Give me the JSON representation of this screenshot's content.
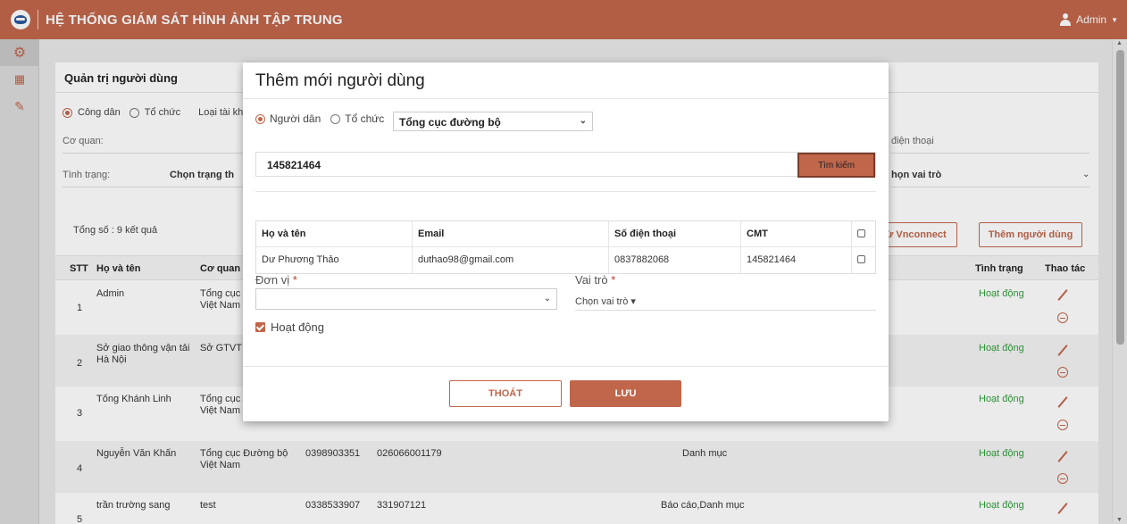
{
  "app": {
    "title": "HỆ THỐNG GIÁM SÁT HÌNH ẢNH TẬP TRUNG",
    "user": "Admin"
  },
  "sidebar": {
    "items": [
      {
        "icon": "gear-icon"
      },
      {
        "icon": "calendar-icon"
      },
      {
        "icon": "edit-icon"
      }
    ]
  },
  "panel": {
    "title": "Quản trị người dùng",
    "radio_citizen": "Công dân",
    "radio_org": "Tổ chức",
    "account_type_label": "Loại tài kh",
    "agency_label": "Cơ quan:",
    "phone_label": "điện thoại",
    "status_label": "Tình trạng:",
    "status_value": "Chọn trạng th",
    "role_value": "họn vai trò",
    "total": "Tổng số : 9 kết quả",
    "vnconnect_button": "ừ Vnconnect",
    "add_user_button": "Thêm người dùng"
  },
  "table": {
    "headers": {
      "stt": "STT",
      "name": "Họ và tên",
      "agency": "Cơ quan",
      "status": "Tình trạng",
      "action": "Thao tác"
    },
    "rows": [
      {
        "stt": "1",
        "name_1": "Admin",
        "name_2": "",
        "agency_1": "Tổng cục",
        "agency_2": "Việt Nam",
        "phone": "",
        "id": "",
        "role": "",
        "status": "Hoạt động"
      },
      {
        "stt": "2",
        "name_1": "Sở giao thông vận tải",
        "name_2": "Hà Nội",
        "agency_1": "Sở GTVT H",
        "agency_2": "",
        "phone": "",
        "id": "",
        "role": "",
        "status": "Hoạt động"
      },
      {
        "stt": "3",
        "name_1": "Tống Khánh Linh",
        "name_2": "",
        "agency_1": "Tổng cục",
        "agency_2": "Việt Nam",
        "phone": "",
        "id": "",
        "role": "",
        "status": "Hoạt động"
      },
      {
        "stt": "4",
        "name_1": "Nguyễn Văn Khấn",
        "name_2": "",
        "agency_1": "Tổng cục Đường bộ",
        "agency_2": "Việt Nam",
        "phone": "0398903351",
        "id": "026066001179",
        "role": "Danh mục",
        "status": "Hoạt động"
      },
      {
        "stt": "5",
        "name_1": "trần trường sang",
        "name_2": "",
        "agency_1": "test",
        "agency_2": "",
        "phone": "0338533907",
        "id": "331907121",
        "role": "Báo cáo,Danh mục",
        "status": "Hoạt động"
      }
    ]
  },
  "modal": {
    "title": "Thêm mới người dùng",
    "radio_citizen": "Người dân",
    "radio_org": "Tổ chức",
    "agency_select": "Tổng cục đường bộ",
    "search_value": "145821464",
    "search_button": "Tìm kiếm",
    "result_headers": {
      "name": "Họ và tên",
      "email": "Email",
      "phone": "Số điện thoại",
      "id": "CMT"
    },
    "result_row": {
      "name": "Dư Phương Thảo",
      "email": "duthao98@gmail.com",
      "phone": "0837882068",
      "id": "145821464"
    },
    "unit_label": "Đơn vị",
    "role_label": "Vai trò",
    "required_mark": "*",
    "role_placeholder": "Chọn vai trò ▾",
    "active_label": "Hoạt động",
    "exit_button": "THOÁT",
    "save_button": "LƯU"
  },
  "colors": {
    "brand": "#c0664b",
    "active_status": "#2e9e3a",
    "required": "#c0392b"
  }
}
